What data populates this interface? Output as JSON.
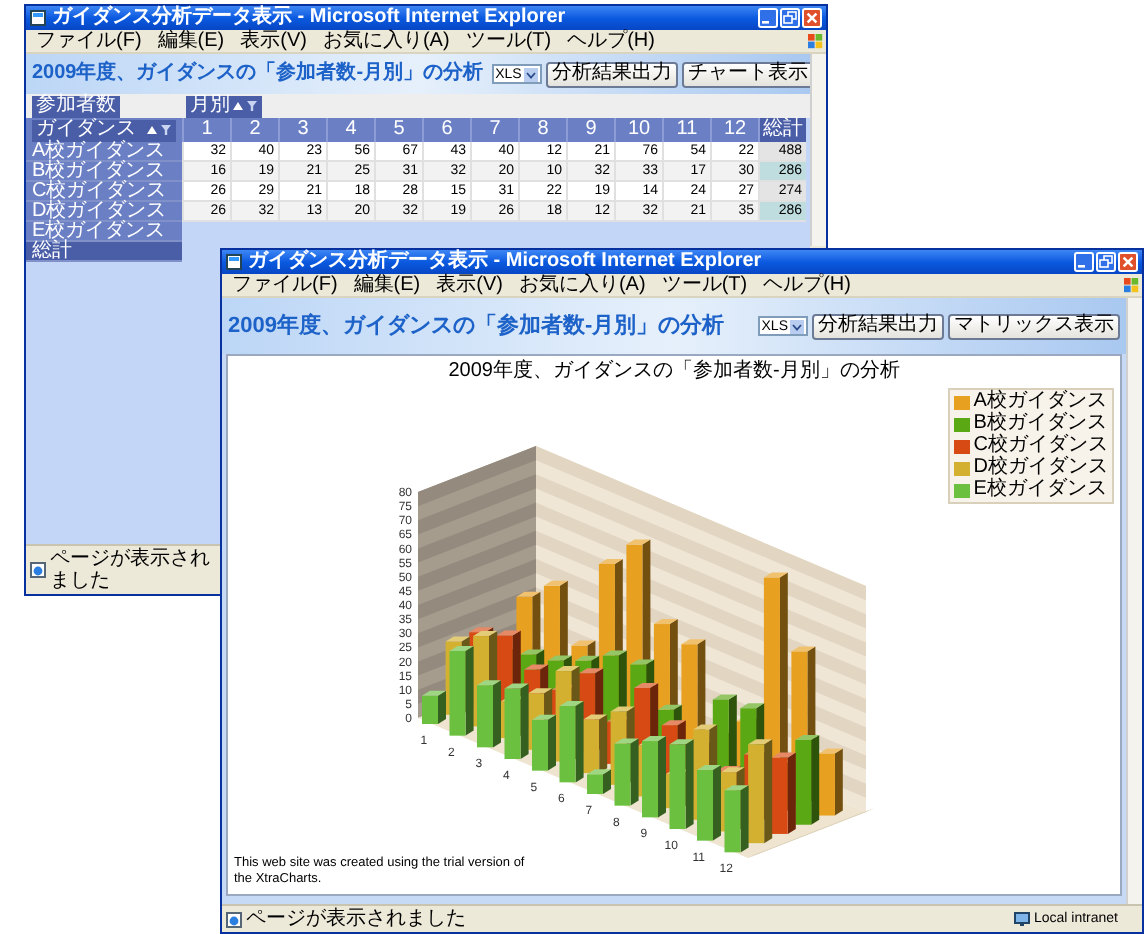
{
  "windows": [
    {
      "title": "ガイダンス分析データ表示 - Microsoft Internet Explorer",
      "menu": [
        "ファイル(F)",
        "編集(E)",
        "表示(V)",
        "お気に入り(A)",
        "ツール(T)",
        "ヘルプ(H)"
      ],
      "page": {
        "heading": "2009年度、ガイダンスの「参加者数-月別」の分析",
        "format": "XLS",
        "buttons": [
          "分析結果出力",
          "チャート表示"
        ],
        "pivot": {
          "data_field": "参加者数",
          "column_field": "月別",
          "row_field": "ガイダンス",
          "columns": [
            "1",
            "2",
            "3",
            "4",
            "5",
            "6",
            "7",
            "8",
            "9",
            "10",
            "11",
            "12",
            "総計"
          ],
          "rows": [
            {
              "label": "A校ガイダンス",
              "cells": [
                "32",
                "40",
                "23",
                "56",
                "67",
                "43",
                "40",
                "12",
                "21",
                "76",
                "54",
                "22",
                "488"
              ]
            },
            {
              "label": "B校ガイダンス",
              "cells": [
                "16",
                "19",
                "21",
                "25",
                "31",
                "32",
                "20",
                "10",
                "32",
                "33",
                "17",
                "30",
                "286"
              ]
            },
            {
              "label": "C校ガイダンス",
              "cells": [
                "26",
                "29",
                "21",
                "18",
                "28",
                "15",
                "31",
                "22",
                "19",
                "14",
                "24",
                "27",
                "274"
              ]
            },
            {
              "label": "D校ガイダンス",
              "cells": [
                "26",
                "32",
                "13",
                "20",
                "32",
                "19",
                "26",
                "18",
                "12",
                "32",
                "21",
                "35",
                "286"
              ]
            },
            {
              "label": "E校ガイダンス"
            },
            {
              "label": "総計"
            }
          ]
        }
      },
      "status": "ページが表示されました"
    },
    {
      "title": "ガイダンス分析データ表示 - Microsoft Internet Explorer",
      "menu": [
        "ファイル(F)",
        "編集(E)",
        "表示(V)",
        "お気に入り(A)",
        "ツール(T)",
        "ヘルプ(H)"
      ],
      "page": {
        "heading": "2009年度、ガイダンスの「参加者数-月別」の分析",
        "format": "XLS",
        "buttons": [
          "分析結果出力",
          "マトリックス表示"
        ],
        "chart": {
          "title": "2009年度、ガイダンスの「参加者数-月別」の分析",
          "y_axis_labels": [
            "80",
            "75",
            "70",
            "65",
            "60",
            "55",
            "50",
            "45",
            "40",
            "35",
            "30",
            "25",
            "20",
            "15",
            "10",
            "5",
            "0"
          ],
          "x_axis_labels": [
            "1",
            "2",
            "3",
            "4",
            "5",
            "6",
            "7",
            "8",
            "9",
            "10",
            "11",
            "12"
          ],
          "legend": [
            {
              "label": "A校ガイダンス",
              "color": "#e8a020"
            },
            {
              "label": "B校ガイダンス",
              "color": "#5aa814"
            },
            {
              "label": "C校ガイダンス",
              "color": "#d84a14"
            },
            {
              "label": "D校ガイダンス",
              "color": "#d4b030"
            },
            {
              "label": "E校ガイダンス",
              "color": "#6cc040"
            }
          ],
          "note": "This web site was created using the trial version of the XtraCharts."
        }
      },
      "status": "ページが表示されました",
      "zone": "Local intranet"
    }
  ]
}
